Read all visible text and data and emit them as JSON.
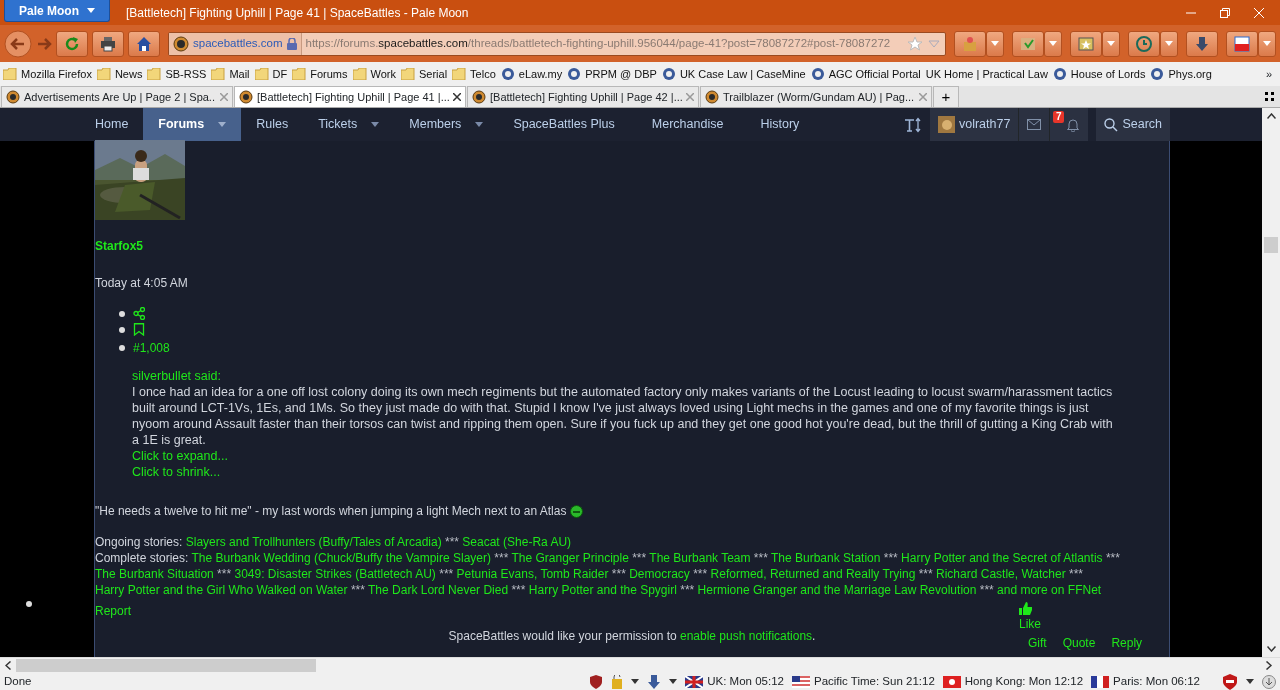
{
  "window": {
    "app_button": "Pale Moon",
    "title": "[Battletech] Fighting Uphill | Page 41 | SpaceBattles - Pale Moon"
  },
  "address_bar": {
    "identity": "spacebattles.com",
    "url_prefix": "https://forums.",
    "url_domain": "spacebattles.com",
    "url_path": "/threads/battletech-fighting-uphill.956044/page-41?post=78087272#post-78087272"
  },
  "bookmarks": [
    {
      "label": "Mozilla Firefox",
      "kind": "folder"
    },
    {
      "label": "News",
      "kind": "folder"
    },
    {
      "label": "SB-RSS",
      "kind": "folder"
    },
    {
      "label": "Mail",
      "kind": "folder"
    },
    {
      "label": "DF",
      "kind": "folder"
    },
    {
      "label": "Forums",
      "kind": "folder"
    },
    {
      "label": "Work",
      "kind": "folder"
    },
    {
      "label": "Serial",
      "kind": "folder"
    },
    {
      "label": "Telco",
      "kind": "folder"
    },
    {
      "label": "eLaw.my",
      "kind": "site"
    },
    {
      "label": "PRPM @ DBP",
      "kind": "site"
    },
    {
      "label": "UK Case Law | CaseMine",
      "kind": "site"
    },
    {
      "label": "AGC Official Portal",
      "kind": "site"
    },
    {
      "label": "UK Home | Practical Law",
      "kind": "plain"
    },
    {
      "label": "House of Lords",
      "kind": "site"
    },
    {
      "label": "Phys.org",
      "kind": "site"
    }
  ],
  "bookmarks_overflow": "»",
  "tabs": [
    {
      "title": "Advertisements Are Up | Page 2 | Spa...",
      "selected": false
    },
    {
      "title": "[Battletech] Fighting Uphill | Page 41 |...",
      "selected": true
    },
    {
      "title": "[Battletech] Fighting Uphill | Page 42 |...",
      "selected": false
    },
    {
      "title": "Trailblazer (Worm/Gundam AU) | Pag...",
      "selected": false
    }
  ],
  "new_tab": "+",
  "site_nav": [
    {
      "label": "Home",
      "dropdown": false,
      "selected": false
    },
    {
      "label": "Forums",
      "dropdown": true,
      "selected": true
    },
    {
      "label": "Rules",
      "dropdown": false,
      "selected": false
    },
    {
      "label": "Tickets",
      "dropdown": true,
      "selected": false
    },
    {
      "label": "Members",
      "dropdown": true,
      "selected": false
    },
    {
      "label": "SpaceBattles Plus",
      "dropdown": false,
      "selected": false
    },
    {
      "label": "Merchandise",
      "dropdown": false,
      "selected": false
    },
    {
      "label": "History",
      "dropdown": false,
      "selected": false
    }
  ],
  "user": {
    "name": "volrath77",
    "alerts_badge": "7",
    "search": "Search"
  },
  "post": {
    "avatar": {
      "kind": "picture"
    },
    "username": "Starfox5",
    "time": "Today at 4:05 AM",
    "post_number": "#1,008",
    "quote": {
      "author": "silverbullet said:",
      "text": "I once had an idea for a one off lost colony doing its own mech regiments but the automated factory only makes variants of the Locust leading to locust swarm/harassment tactics built around LCT-1Vs, 1Es, and 1Ms. So they just made do with that. Stupid I know I've just always loved using Light mechs in the games and one of my favorite things is just nyoom around Assault faster than their torsos can twist and ripping them open. Sure if you fuck up and they get one good hot you're dead, but the thrill of gutting a King Crab with a 1E is great.",
      "expand": "Click to expand...",
      "shrink": "Click to shrink..."
    },
    "signature": {
      "quote": "\"He needs a twelve to hit me\" - my last words when jumping a light Mech next to an Atlas",
      "lines": [
        {
          "label": "Ongoing stories:",
          "parts": [
            {
              "kind": "link",
              "text": "Slayers and Trollhunters (Buffy/Tales of Arcadia)"
            },
            {
              "kind": "sep",
              "text": "***"
            },
            {
              "kind": "link",
              "text": "Seacat (She-Ra AU)"
            }
          ]
        },
        {
          "label": "Complete stories:",
          "parts": [
            {
              "kind": "link",
              "text": "The Burbank Wedding (Chuck/Buffy the Vampire Slayer)"
            },
            {
              "kind": "sep",
              "text": "***"
            },
            {
              "kind": "link",
              "text": "The Granger Principle"
            },
            {
              "kind": "sep",
              "text": "***"
            },
            {
              "kind": "link",
              "text": "The Burbank Team"
            },
            {
              "kind": "sep",
              "text": "***"
            },
            {
              "kind": "link",
              "text": "The Burbank Station"
            },
            {
              "kind": "sep",
              "text": "***"
            },
            {
              "kind": "link",
              "text": "Harry Potter and the Secret of Atlantis"
            },
            {
              "kind": "sep",
              "text": "***"
            },
            {
              "kind": "link",
              "text": "The Burbank Situation"
            },
            {
              "kind": "sep",
              "text": "***"
            },
            {
              "kind": "link",
              "text": "3049: Disaster Strikes (Battletech AU)"
            },
            {
              "kind": "sep",
              "text": "***"
            },
            {
              "kind": "link",
              "text": "Petunia Evans, Tomb Raider"
            },
            {
              "kind": "sep",
              "text": "***"
            },
            {
              "kind": "link",
              "text": "Democracy"
            },
            {
              "kind": "sep",
              "text": "***"
            },
            {
              "kind": "link",
              "text": "Reformed, Returned and Really Trying"
            },
            {
              "kind": "sep",
              "text": "***"
            },
            {
              "kind": "link",
              "text": "Richard Castle, Watcher"
            },
            {
              "kind": "sep",
              "text": "***"
            },
            {
              "kind": "link",
              "text": "Harry Potter and the Girl Who Walked on Water"
            },
            {
              "kind": "sep",
              "text": "***"
            },
            {
              "kind": "link",
              "text": "The Dark Lord Never Died"
            },
            {
              "kind": "sep",
              "text": "***"
            },
            {
              "kind": "link",
              "text": "Harry Potter and the Spygirl"
            },
            {
              "kind": "sep",
              "text": "***"
            },
            {
              "kind": "link",
              "text": "Hermione Granger and the Marriage Law Revolution"
            },
            {
              "kind": "sep",
              "text": "***"
            },
            {
              "kind": "link",
              "text": "and more on FFNet"
            }
          ]
        }
      ]
    },
    "report": "Report",
    "like": "Like",
    "actions": [
      "Gift",
      "Quote",
      "Reply"
    ]
  },
  "notice": {
    "text": "SpaceBattles would like your permission to",
    "link": "enable push notifications",
    "end": "."
  },
  "status_bar": {
    "text": "Done",
    "clocks": [
      {
        "kind": "uk",
        "label": "UK: Mon 05:12"
      },
      {
        "kind": "us",
        "label": "Pacific Time: Sun 21:12"
      },
      {
        "kind": "hk",
        "label": "Hong Kong: Mon 12:12"
      },
      {
        "kind": "fr",
        "label": "Paris: Mon 06:12"
      }
    ]
  }
}
